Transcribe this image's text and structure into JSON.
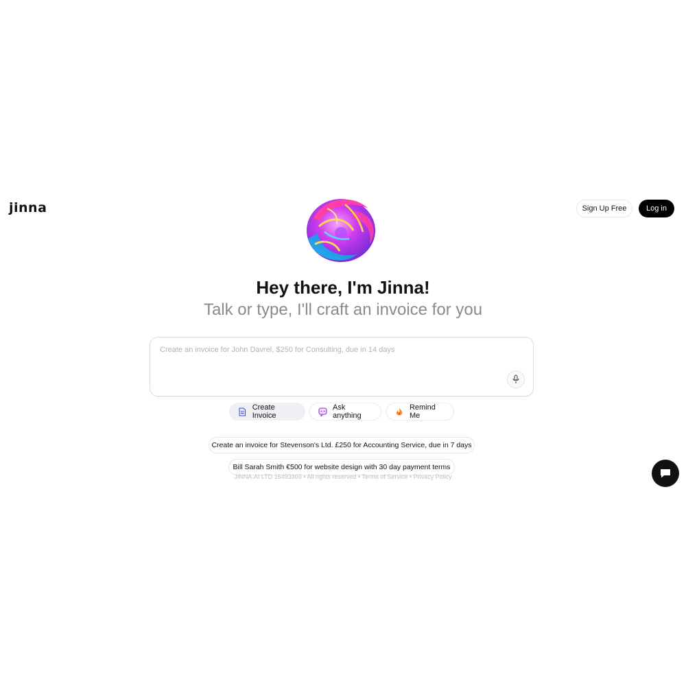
{
  "brand": {
    "logo_text": "jinna"
  },
  "header": {
    "signup_label": "Sign Up Free",
    "login_label": "Log in"
  },
  "hero": {
    "title": "Hey there, I'm Jinna!",
    "subtitle": "Talk or type, I'll craft an invoice for you"
  },
  "prompt": {
    "placeholder": "Create an invoice for John Davrel, $250 for Consulting, due in 14 days",
    "value": ""
  },
  "modes": [
    {
      "label": "Create Invoice",
      "icon": "document-icon",
      "active": true
    },
    {
      "label": "Ask anything",
      "icon": "chat-bubble-icon",
      "active": false
    },
    {
      "label": "Remind Me",
      "icon": "flame-icon",
      "active": false
    }
  ],
  "suggestions": [
    "Create an invoice for Stevenson's Ltd. £250 for Accounting Service, due in 7 days",
    "Bill Sarah Smith €500 for website design with 30 day payment terms"
  ],
  "footer": {
    "company": "JINNA.AI LTD 16493360",
    "rights": "All rights reserved",
    "terms": "Terms of Service",
    "privacy": "Privacy Policy",
    "separator": "•"
  },
  "colors": {
    "primary": "#000000",
    "muted_text": "#8a8a8a",
    "chip_active_bg": "#eef0f3"
  }
}
